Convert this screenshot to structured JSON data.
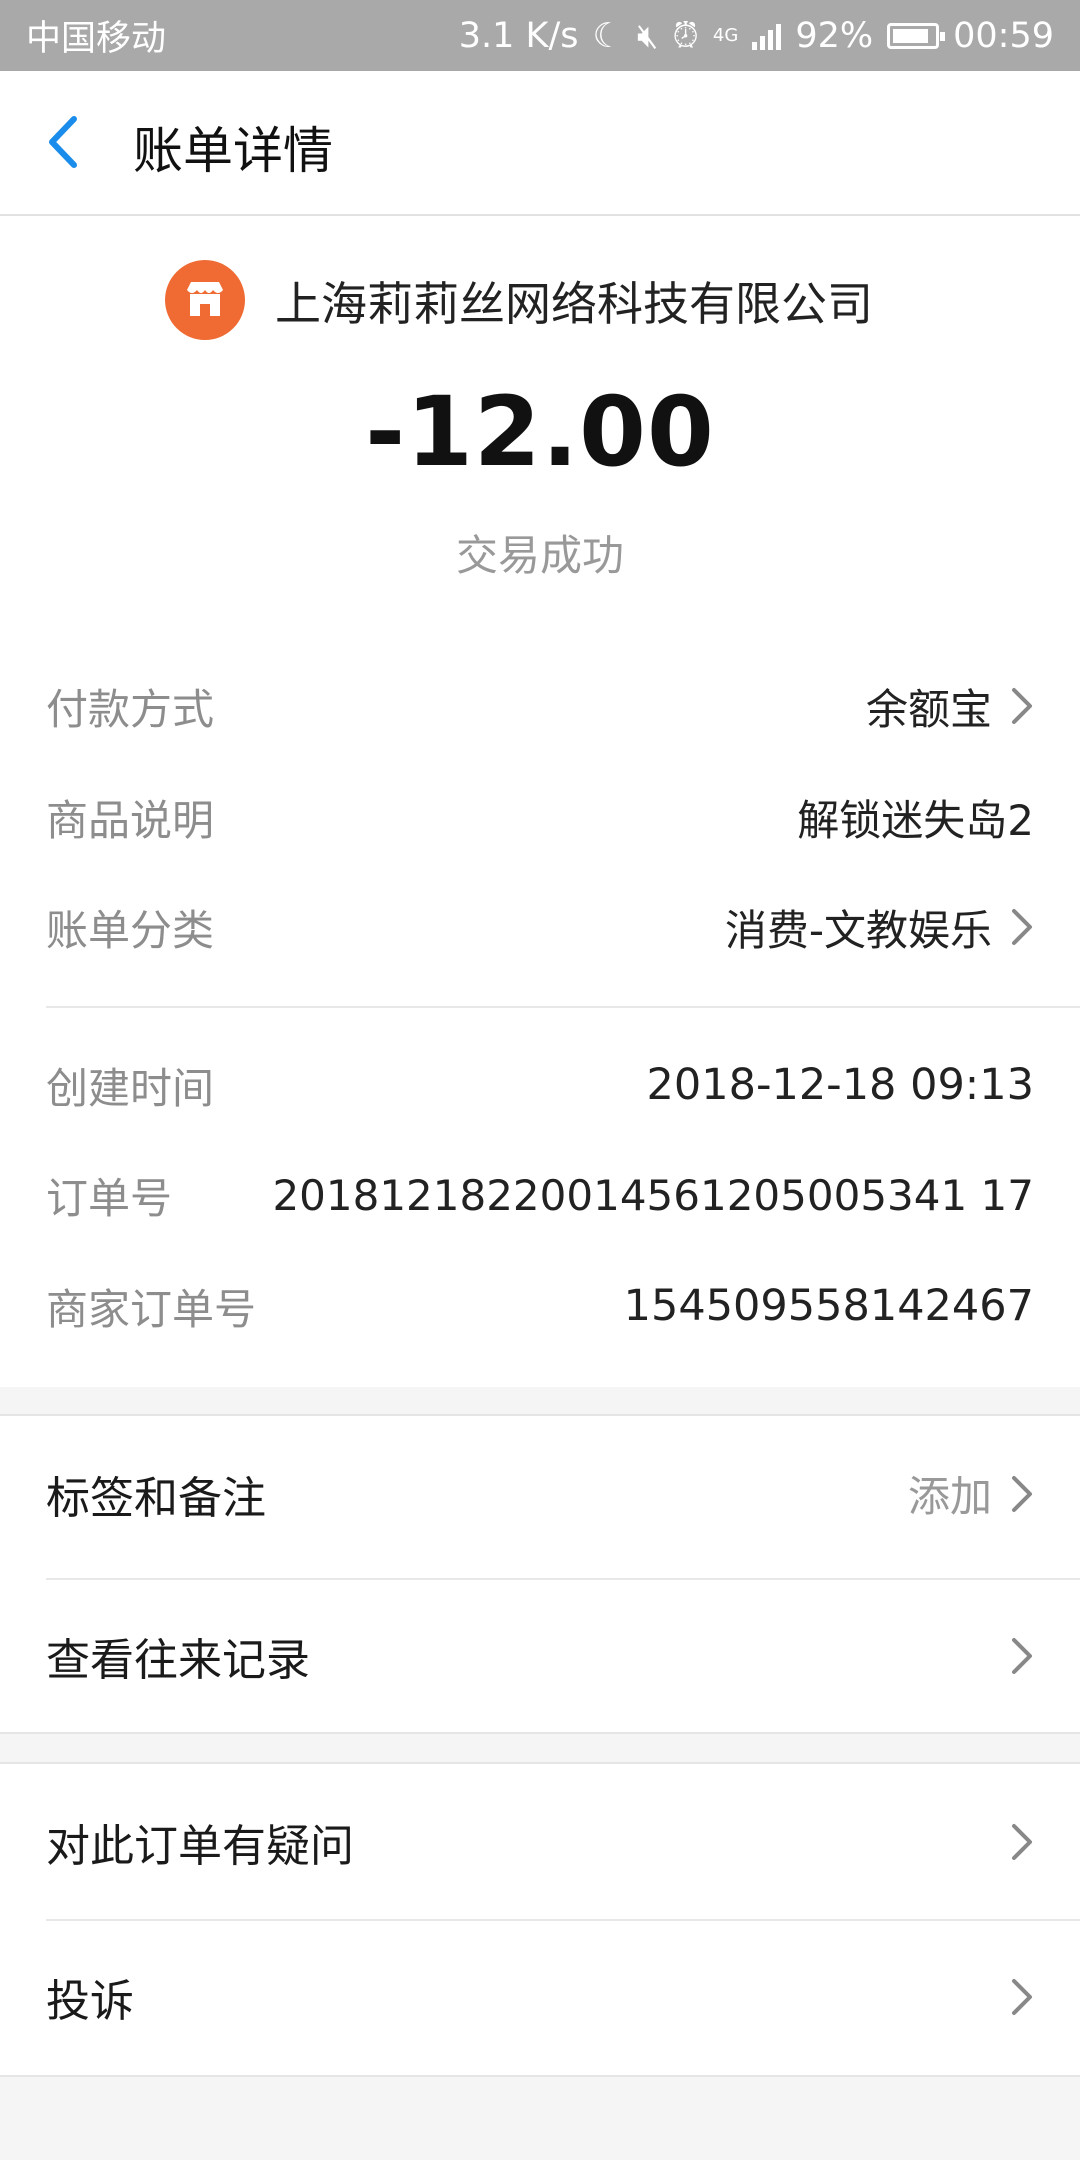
{
  "status_bar": {
    "carrier": "中国移动",
    "speed": "3.1 K/s",
    "network": "4G",
    "battery": "92%",
    "time": "00:59"
  },
  "nav": {
    "title": "账单详情"
  },
  "merchant": {
    "name": "上海莉莉丝网络科技有限公司",
    "icon": "store-icon"
  },
  "transaction": {
    "amount": "-12.00",
    "status": "交易成功"
  },
  "details": [
    {
      "label": "付款方式",
      "value": "余额宝"
    },
    {
      "label": "商品说明",
      "value": "解锁迷失岛2"
    },
    {
      "label": "账单分类",
      "value": "消费-文教娱乐"
    },
    {
      "label": "创建时间",
      "value": "2018-12-18 09:13"
    },
    {
      "label": "订单号",
      "value": "20181218220014561205005341 17"
    },
    {
      "label": "商家订单号",
      "value": "154509558142467"
    }
  ],
  "actions": {
    "tags_label": "标签和备注",
    "tags_action": "添加",
    "history_label": "查看往来记录",
    "question_label": "对此订单有疑问",
    "complaint_label": "投诉"
  },
  "colors": {
    "accent": "#1a8ceb",
    "merchant_logo": "#ef6b33",
    "status_bar": "#a9a9a9"
  }
}
